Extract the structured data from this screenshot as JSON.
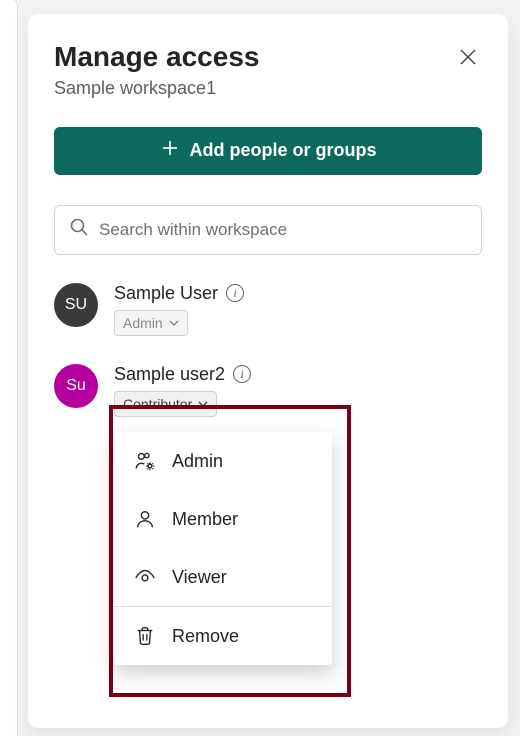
{
  "header": {
    "title": "Manage access",
    "subtitle": "Sample workspace1"
  },
  "actions": {
    "add_label": "Add people or groups"
  },
  "search": {
    "placeholder": "Search within workspace"
  },
  "users": [
    {
      "initials": "SU",
      "name": "Sample User",
      "role_label": "Admin",
      "avatar_color": "dark",
      "role_disabled": true
    },
    {
      "initials": "Su",
      "name": "Sample user2",
      "role_label": "Contributor",
      "avatar_color": "magenta",
      "role_disabled": false
    }
  ],
  "role_menu": {
    "items": [
      {
        "label": "Admin",
        "icon": "people-gear-icon"
      },
      {
        "label": "Member",
        "icon": "person-icon"
      },
      {
        "label": "Viewer",
        "icon": "eye-icon"
      }
    ],
    "remove_label": "Remove"
  }
}
